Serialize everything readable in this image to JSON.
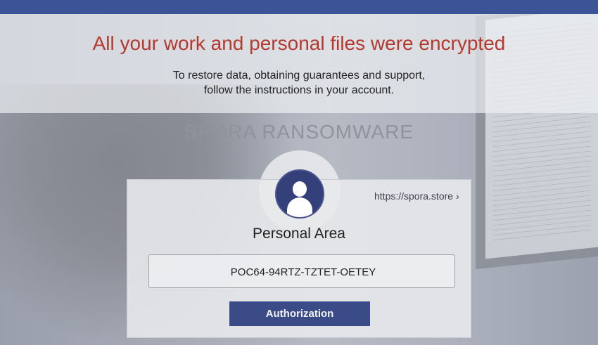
{
  "header": {
    "headline": "All your work and personal files were encrypted",
    "subtitle_line1": "To restore data, obtaining guarantees and support,",
    "subtitle_line2": "follow the instructions in your account."
  },
  "brand": "SPORA RANSOMWARE",
  "panel": {
    "avatar_icon": "user-icon",
    "link_text": "https://spora.store ›",
    "title": "Personal Area",
    "key_value": "POC64-94RTZ-TZTET-OETEY",
    "button_label": "Authorization"
  },
  "colors": {
    "headline": "#b5392c",
    "accent": "#3a4b87",
    "topbar": "#3a5496"
  }
}
